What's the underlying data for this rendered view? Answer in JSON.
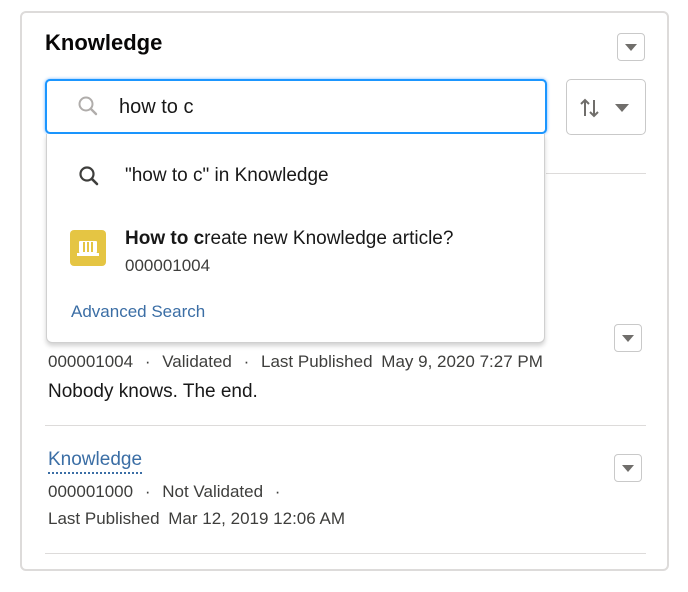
{
  "card": {
    "title": "Knowledge"
  },
  "search": {
    "value": "how to c"
  },
  "dropdown": {
    "search_option": "\"how to c\" in Knowledge",
    "article_title_bold": "How to c",
    "article_title_rest": "reate new Knowledge article?",
    "article_number": "000001004",
    "advanced_search": "Advanced Search"
  },
  "results": [
    {
      "number": "000001004",
      "status": "Validated",
      "published_label": "Last Published",
      "published_date": "May 9, 2020 7:27 PM",
      "summary": "Nobody knows. The end."
    },
    {
      "title": "Knowledge",
      "number": "000001000",
      "status": "Not Validated",
      "published_label": "Last Published",
      "published_date": "Mar 12, 2019 12:06 AM"
    }
  ],
  "separator": "·",
  "colors": {
    "focus_border": "#1b96ff",
    "link": "#3b6ea5",
    "article_icon": "#e5c543"
  },
  "icons": {
    "search": "search-icon",
    "sort": "sort-icon",
    "menu": "chevron-down-icon",
    "article": "knowledge-article-icon"
  }
}
